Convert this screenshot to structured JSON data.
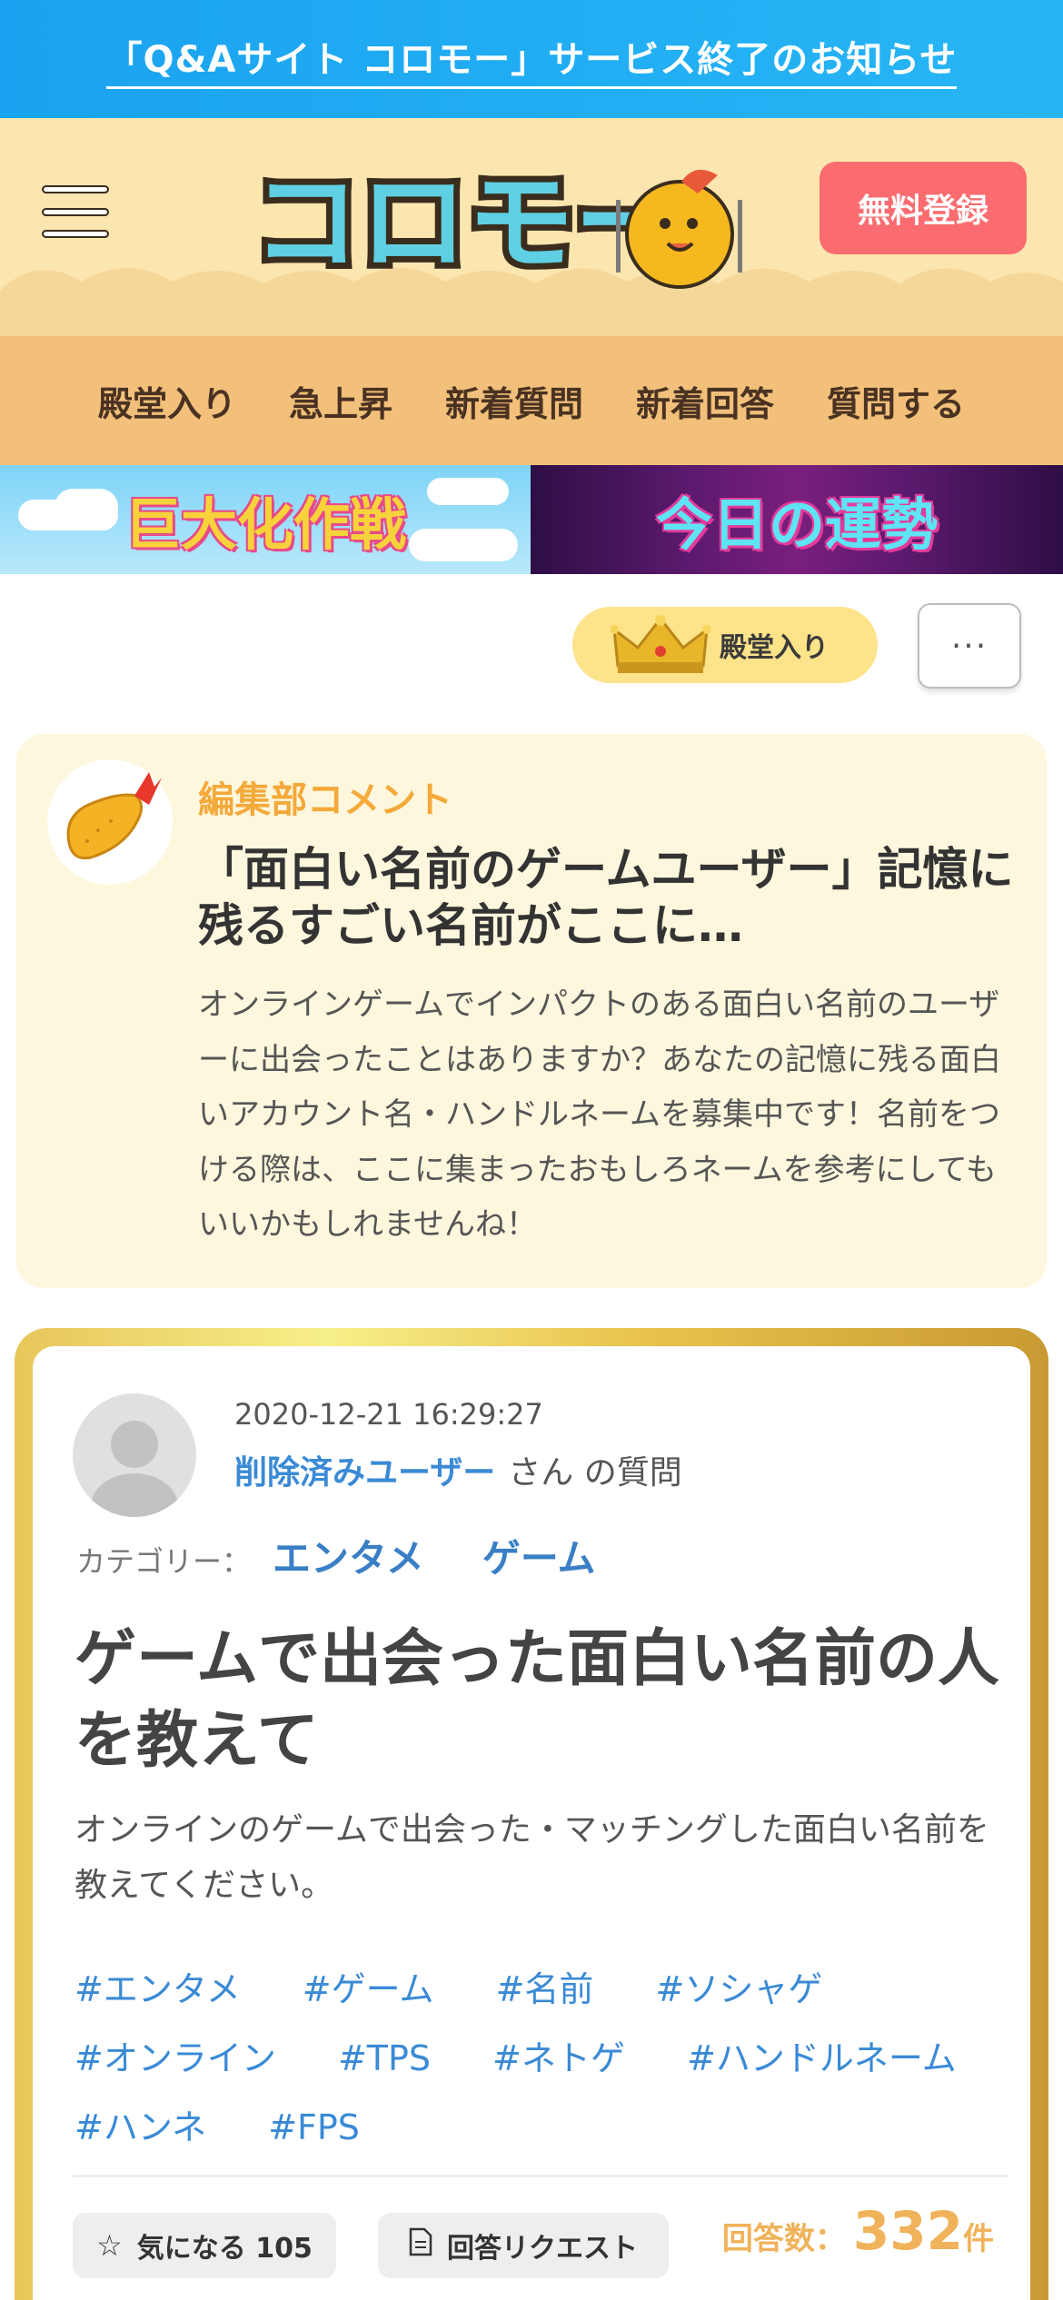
{
  "notice": {
    "text": "「Q&Aサイト コロモー」サービス終了のお知らせ"
  },
  "header": {
    "logo_text": "コロモー",
    "signup_label": "無料登録"
  },
  "nav": {
    "items": [
      {
        "label": "殿堂入り"
      },
      {
        "label": "急上昇"
      },
      {
        "label": "新着質問"
      },
      {
        "label": "新着回答"
      },
      {
        "label": "質問する"
      }
    ]
  },
  "banners": [
    {
      "title": "巨大化作戦"
    },
    {
      "title": "今日の運勢"
    }
  ],
  "actions": {
    "hall_of_fame_label": "殿堂入り",
    "more_label": "···"
  },
  "editorial": {
    "label": "編集部コメント",
    "title": "「面白い名前のゲームユーザー」記憶に残るすごい名前がここに…",
    "body": "オンラインゲームでインパクトのある面白い名前のユーザーに出会ったことはありますか？あなたの記憶に残る面白いアカウント名・ハンドルネームを募集中です！名前をつける際は、ここに集まったおもしろネームを参考にしてもいいかもしれませんね！"
  },
  "question": {
    "timestamp": "2020-12-21 16:29:27",
    "user": "削除済みユーザー",
    "byline_suffix": "さん の質問",
    "category_label": "カテゴリー：",
    "categories": [
      "エンタメ",
      "ゲーム"
    ],
    "title": "ゲームで出会った面白い名前の人を教えて",
    "body": "オンラインのゲームで出会った・マッチングした面白い名前を教えてください。",
    "tags": [
      "#エンタメ",
      "#ゲーム",
      "#名前",
      "#ソシャゲ",
      "#オンライン",
      "#TPS",
      "#ネトゲ",
      "#ハンドルネーム",
      "#ハンネ",
      "#FPS"
    ],
    "watch_label": "気になる 105",
    "request_label": "回答リクエスト",
    "answers_label": "回答数：",
    "answers_count": "332",
    "answers_unit": "件"
  },
  "colors": {
    "notice_bg": "#1aa3f0",
    "header_bg": "#fbe6b0",
    "nav_bg": "#f2c07a",
    "signup_bg": "#fb6c70",
    "accent_orange": "#f4a93b",
    "link_blue": "#3a8ad6"
  },
  "icons": {
    "menu": "hamburger-icon",
    "crown": "crown-icon",
    "star": "star-outline-icon",
    "document": "document-icon",
    "mascot": "mascot-icon",
    "editor_avatar": "fried-shrimp-icon",
    "user_avatar": "default-user-icon"
  }
}
